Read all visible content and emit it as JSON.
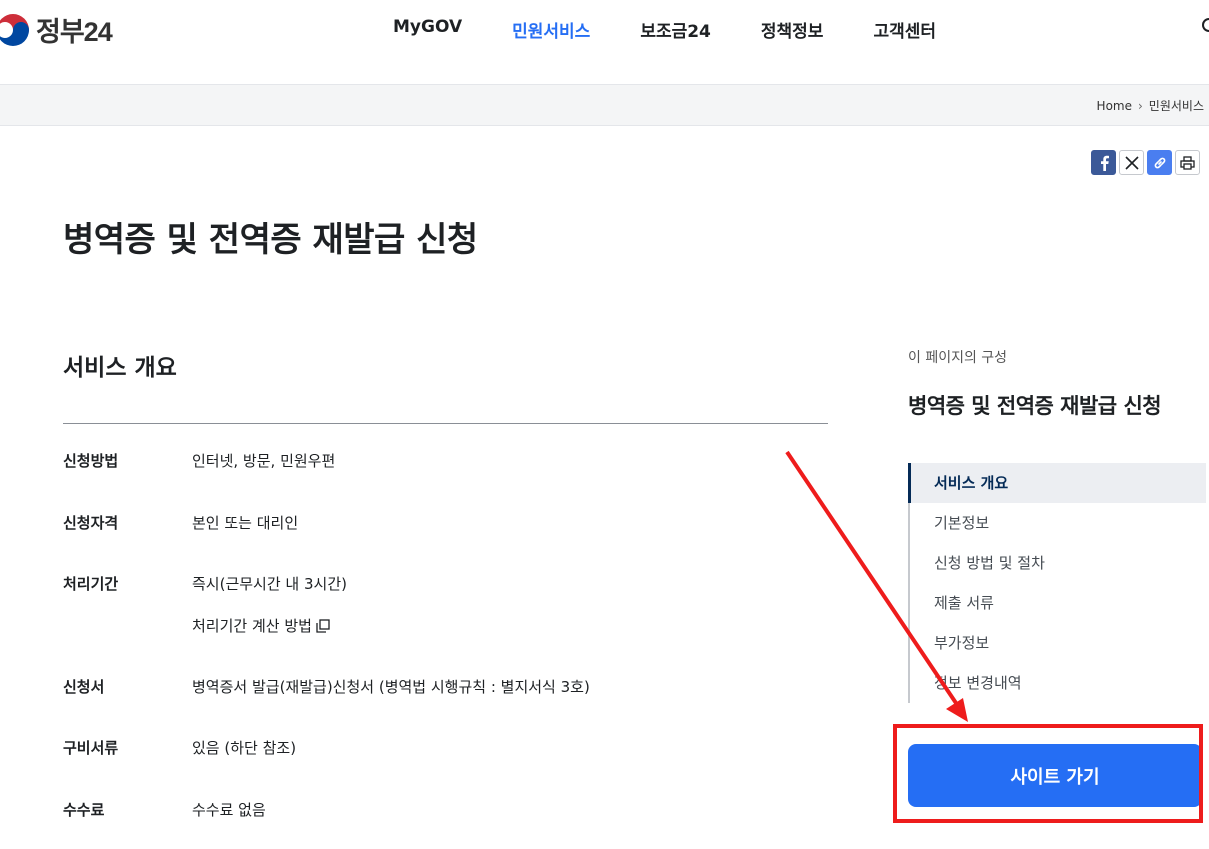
{
  "header": {
    "logo_text": "정부24",
    "nav": [
      "MyGOV",
      "민원서비스",
      "보조금24",
      "정책정보",
      "고객센터"
    ],
    "active_nav": "민원서비스"
  },
  "breadcrumb": {
    "home": "Home",
    "current": "민원서비스"
  },
  "page_title": "병역증 및 전역증 재발급 신청",
  "section": {
    "title": "서비스 개요",
    "rows": [
      {
        "label": "신청방법",
        "value": "인터넷, 방문, 민원우편"
      },
      {
        "label": "신청자격",
        "value": "본인 또는 대리인"
      },
      {
        "label": "처리기간",
        "value": "즉시(근무시간 내 3시간)",
        "link": "처리기간 계산 방법"
      },
      {
        "label": "신청서",
        "value": "병역증서 발급(재발급)신청서 (병역법 시행규칙 : 별지서식 3호)"
      },
      {
        "label": "구비서류",
        "value": "있음 (하단 참조)"
      },
      {
        "label": "수수료",
        "value": "수수료 없음"
      }
    ]
  },
  "toc": {
    "caption": "이 페이지의 구성",
    "title": "병역증 및 전역증 재발급 신청",
    "items": [
      "서비스 개요",
      "기본정보",
      "신청 방법 및 절차",
      "제출 서류",
      "부가정보",
      "정보 변경내역"
    ],
    "active": "서비스 개요"
  },
  "site_button": "사이트 가기",
  "colors": {
    "primary": "#256ef4",
    "annotation": "#ee1c1c",
    "toc_active": "#052b57"
  }
}
